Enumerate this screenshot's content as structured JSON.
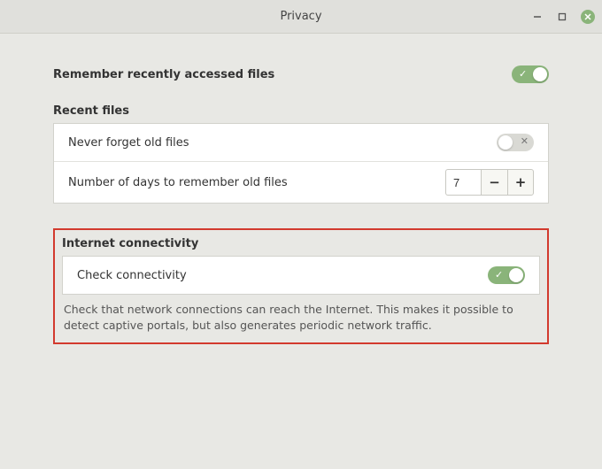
{
  "window": {
    "title": "Privacy"
  },
  "remember": {
    "label": "Remember recently accessed files",
    "enabled": true
  },
  "recent_files": {
    "header": "Recent files",
    "never_forget": {
      "label": "Never forget old files",
      "enabled": false
    },
    "days": {
      "label": "Number of days to remember old files",
      "value": "7"
    }
  },
  "connectivity": {
    "header": "Internet connectivity",
    "check": {
      "label": "Check connectivity",
      "enabled": true
    },
    "description": "Check that network connections can reach the Internet. This makes it possible to detect captive portals, but also generates periodic network traffic."
  }
}
